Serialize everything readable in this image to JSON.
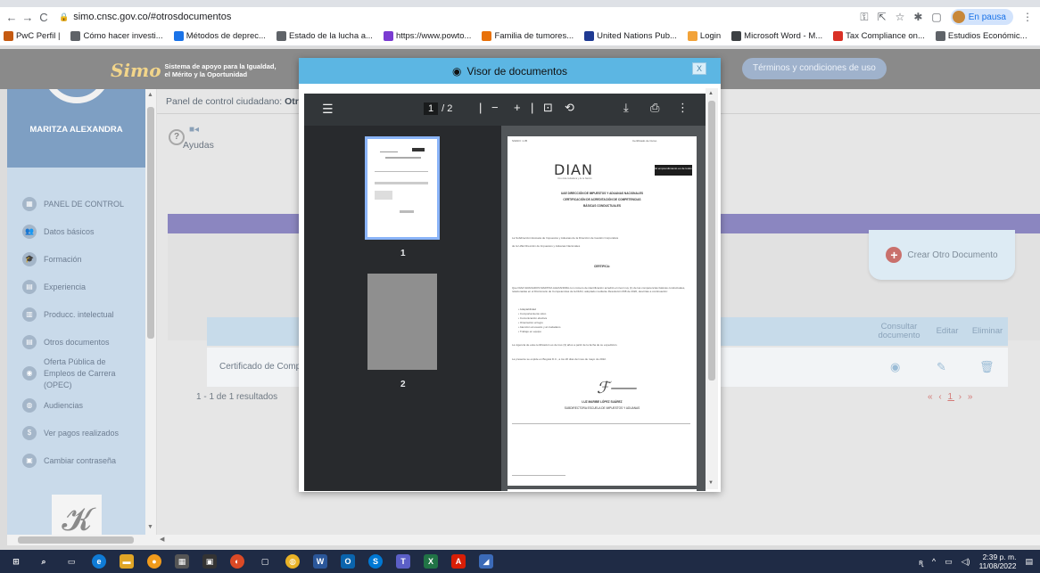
{
  "browser": {
    "url": "simo.cnsc.gov.co/#otrosdocumentos",
    "profile_status": "En pausa",
    "bookmarks": [
      {
        "label": "PwC Perfil |",
        "color": "#c55a11"
      },
      {
        "label": "Cómo hacer investi...",
        "color": "#5f6368"
      },
      {
        "label": "Métodos de deprec...",
        "color": "#1a73e8"
      },
      {
        "label": "Estado de la lucha a...",
        "color": "#5f6368"
      },
      {
        "label": "https://www.powto...",
        "color": "#7a3bd1"
      },
      {
        "label": "Familia de tumores...",
        "color": "#e8710a"
      },
      {
        "label": "United Nations Pub...",
        "color": "#1f3a93"
      },
      {
        "label": "Login",
        "color": "#f2a33a"
      },
      {
        "label": "Microsoft Word - M...",
        "color": "#3c4043"
      },
      {
        "label": "Tax Compliance on...",
        "color": "#d93025"
      },
      {
        "label": "Estudios Económic...",
        "color": "#5f6368"
      }
    ]
  },
  "app": {
    "logo_text": "Simo",
    "logo_tagline_1": "Sistema de apoyo para la Igualdad,",
    "logo_tagline_2": "el Mérito y la Oportunidad",
    "terms_button": "Términos y condiciones de uso"
  },
  "sidebar": {
    "user_name": "MARITZA ALEXANDRA",
    "items": [
      {
        "label": "PANEL DE CONTROL",
        "icon": "dashboard-icon"
      },
      {
        "label": "Datos básicos",
        "icon": "people-icon"
      },
      {
        "label": "Formación",
        "icon": "graduation-icon"
      },
      {
        "label": "Experiencia",
        "icon": "briefcase-icon"
      },
      {
        "label": "Producc. intelectual",
        "icon": "book-icon"
      },
      {
        "label": "Otros documentos",
        "icon": "document-icon"
      },
      {
        "label": "Oferta Pública de",
        "label2": "Empleos de Carrera (OPEC)",
        "icon": "offer-icon"
      },
      {
        "label": "Audiencias",
        "icon": "audience-icon"
      },
      {
        "label": "Ver pagos realizados",
        "icon": "dollar-icon"
      },
      {
        "label": "Cambiar contraseña",
        "icon": "lock-icon"
      }
    ]
  },
  "main": {
    "breadcrumb_prefix": "Panel de control ciudadano:",
    "breadcrumb_current": "Otr",
    "help_label": "Ayudas",
    "create_button": "Crear Otro Documento",
    "table": {
      "headers": [
        "Consultar documento",
        "Editar",
        "Eliminar"
      ],
      "row_doc": "Certificado de Compe"
    },
    "results": "1 - 1 de 1 resultados",
    "pager_prev": "« ‹",
    "pager_current": "1",
    "pager_next": "› »"
  },
  "modal": {
    "title": "Visor de documentos",
    "close": "X",
    "pdf": {
      "current_page": "1",
      "total_pages": "/ 2",
      "thumb_1": "1",
      "thumb_2": "2"
    },
    "document": {
      "header_left": "SIGNO: 1.35",
      "header_right": "Certificado de Curso",
      "org": "DIAN",
      "org_sub": "Una vida ciudadana y de la Nación",
      "badge": "El emprendimiento es de todos",
      "title_1": "UAE DIRECCIÓN DE IMPUESTOS Y ADUANAS NACIONALES",
      "title_2": "CERTIFICACIÓN DE ACREDITACIÓN DE COMPETENCIAS",
      "title_3": "BÁSICAS CONDUCTUALES",
      "intro_1": "La Subdirección Escuela de Impuestos y Aduanas de la Dirección de Gestión Corporativa",
      "intro_2": "de la UAE Dirección de Impuestos y Aduanas Nacionales",
      "certifica": "CERTIFICA:",
      "body": "Que DIAZ GRANADOS MARITZA ALEXANDRA con número de identificación acreditó el nivel muy (1) de las competencias básicas conductuales, relacionadas en el Diccionario de Competencias de la DIAN, adoptado mediante Resolución 068 de 2020, descritas a continuación:",
      "bullets": [
        "Adaptabilidad",
        "Comportamiento ético",
        "Comunicación efectiva",
        "Orientación al logro",
        "Atención al usuario y al ciudadano",
        "Trabajo en equipo"
      ],
      "validity": "La vigencia de esta certificación es de tres (3) años a partir de la fecha de su expedición.",
      "issued": "La presente se expide en Bogotá D.C., a los 20 días del mes de mayo de 2022.",
      "signer": "LUZ MARIBE LÓPEZ SUÁREZ",
      "signer_role": "SUBDIRECTORA ESCUELA DE IMPUESTOS Y ADUANAS"
    }
  },
  "taskbar": {
    "time": "2:39 p. m.",
    "date": "11/08/2022"
  }
}
